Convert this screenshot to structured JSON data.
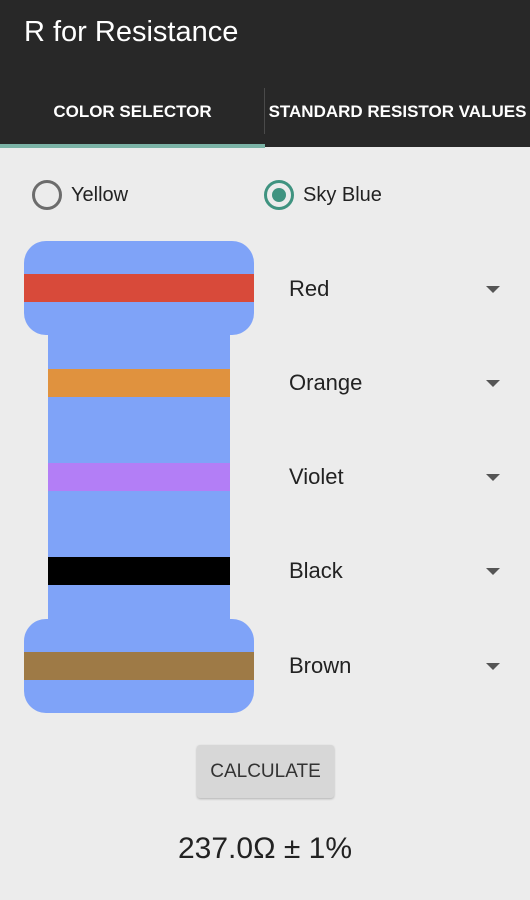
{
  "app": {
    "title": "R for Resistance"
  },
  "tabs": [
    {
      "label": "COLOR SELECTOR",
      "selected": true
    },
    {
      "label": "STANDARD RESISTOR VALUES",
      "selected": false
    }
  ],
  "body_color_options": [
    {
      "label": "Yellow",
      "checked": false
    },
    {
      "label": "Sky Blue",
      "checked": true
    }
  ],
  "resistor": {
    "body_color": "#7fa3f8",
    "bands": [
      {
        "name": "Red",
        "color": "#d84a3a"
      },
      {
        "name": "Orange",
        "color": "#e0923e"
      },
      {
        "name": "Violet",
        "color": "#b37ef6"
      },
      {
        "name": "Black",
        "color": "#000000"
      },
      {
        "name": "Brown",
        "color": "#9e7a46"
      }
    ]
  },
  "calculate_label": "CALCULATE",
  "result": "237.0Ω ± 1%",
  "colors": {
    "appbar": "#282828",
    "accent": "#3f9380",
    "tab_indicator": "#7bb3a6",
    "background": "#ececec"
  }
}
